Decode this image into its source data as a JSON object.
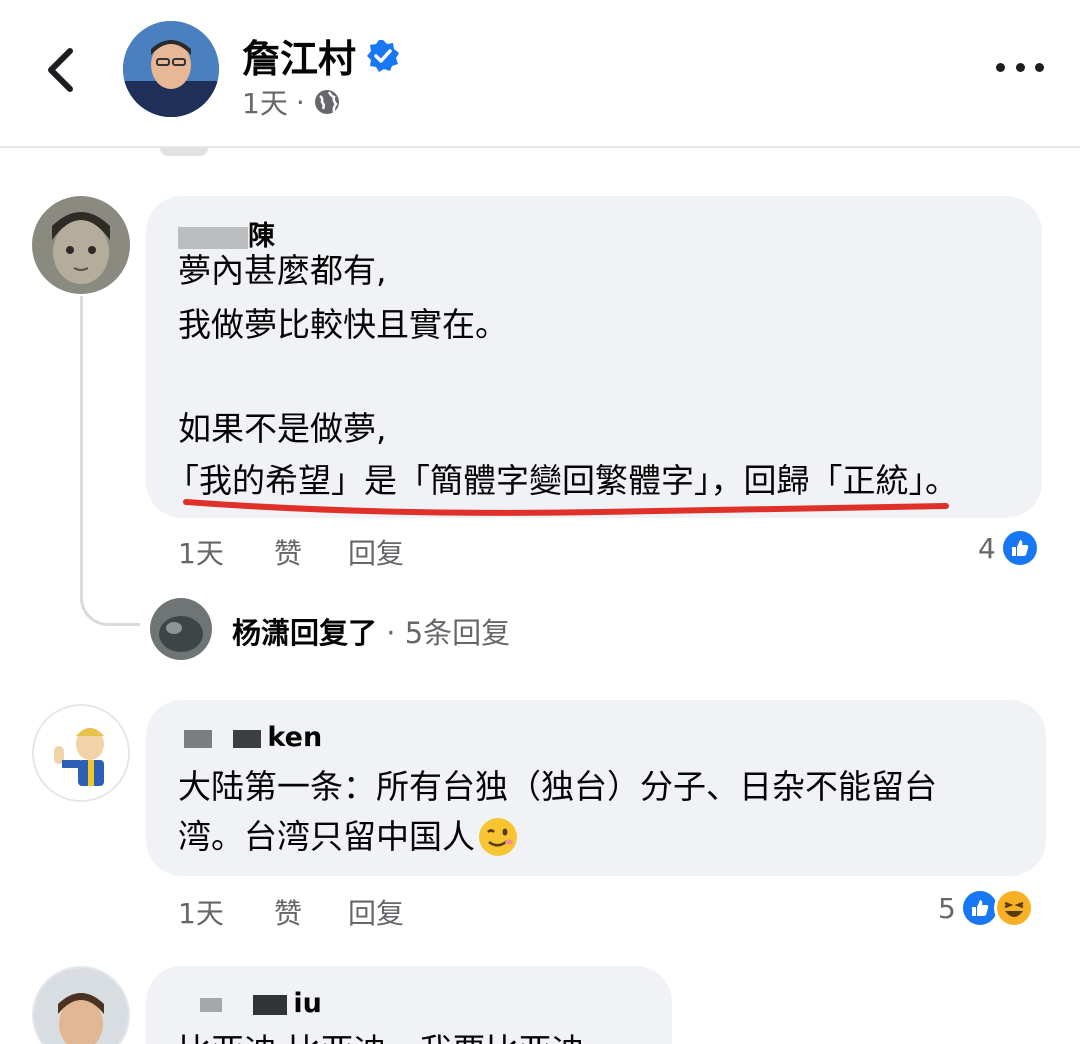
{
  "header": {
    "page_name": "詹江村",
    "time": "1天",
    "separator": "·"
  },
  "comments": [
    {
      "author_visible": "陳",
      "lines": [
        "夢內甚麼都有,",
        "我做夢比較快且實在。",
        "",
        "如果不是做夢,",
        "「我的希望」是「簡體字變回繁體字」，回歸「正統」。"
      ],
      "time": "1天",
      "like_label": "赞",
      "reply_label": "回复",
      "reaction_count": "4",
      "reply_preview": {
        "name": "杨潇",
        "action": "回复了",
        "sep": " · ",
        "count": "5条回复"
      }
    },
    {
      "author_visible": "ken",
      "lines": [
        "大陆第一条：所有台独（独台）分子、日杂不能留台",
        "湾。台湾只留中国人"
      ],
      "time": "1天",
      "like_label": "赞",
      "reply_label": "回复",
      "reaction_count": "5"
    },
    {
      "author_visible": "iu",
      "lines": [
        "比亚迪 比亚迪，我要比亚迪"
      ]
    }
  ],
  "colors": {
    "accent": "#1877f2",
    "underline": "#e0302a",
    "bubble": "#f0f2f5"
  }
}
